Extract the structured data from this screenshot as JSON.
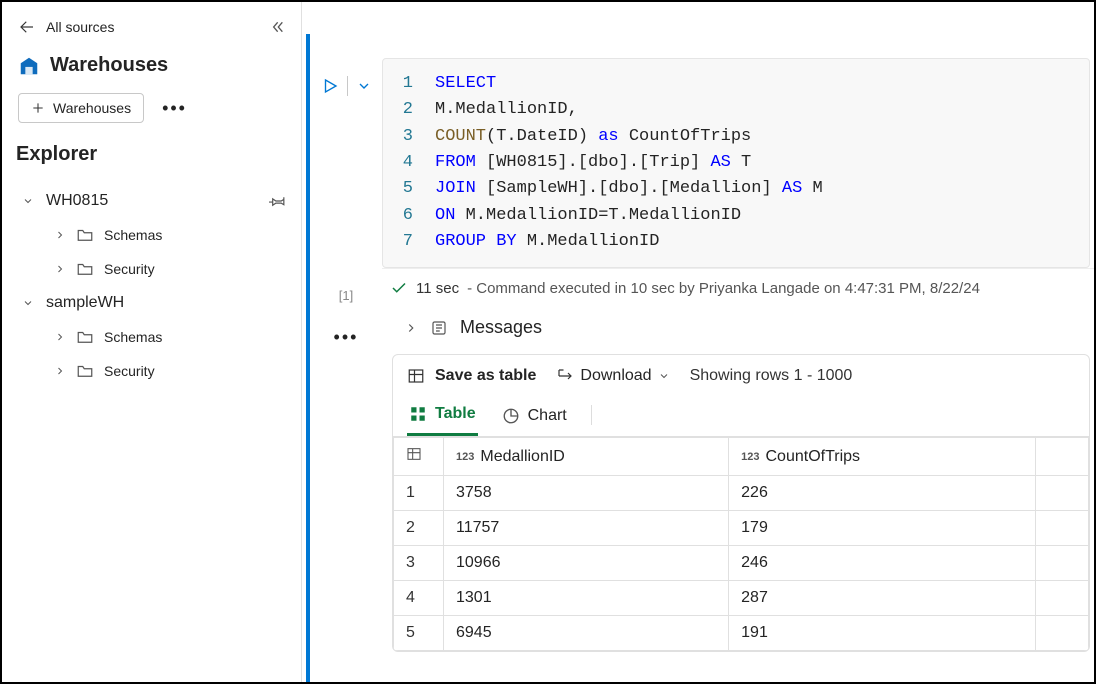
{
  "header": {
    "back_label": "All sources",
    "section_title": "Warehouses",
    "add_button": "Warehouses"
  },
  "explorer": {
    "title": "Explorer",
    "nodes": [
      {
        "label": "WH0815",
        "children": [
          {
            "label": "Schemas"
          },
          {
            "label": "Security"
          }
        ]
      },
      {
        "label": "sampleWH",
        "children": [
          {
            "label": "Schemas"
          },
          {
            "label": "Security"
          }
        ]
      }
    ]
  },
  "editor": {
    "cell_index": "[1]",
    "lines": [
      {
        "n": "1",
        "html": "<span class='kw'>SELECT</span>"
      },
      {
        "n": "2",
        "html": "M.MedallionID,"
      },
      {
        "n": "3",
        "html": "<span class='fn'>COUNT</span>(T.DateID) <span class='kw'>as</span> CountOfTrips"
      },
      {
        "n": "4",
        "html": "<span class='kw'>FROM</span> [WH0815].[dbo].[Trip] <span class='kw'>AS</span> T"
      },
      {
        "n": "5",
        "html": "<span class='kw'>JOIN</span> [SampleWH].[dbo].[Medallion] <span class='kw'>AS</span> M"
      },
      {
        "n": "6",
        "html": "<span class='kw'>ON</span> M.MedallionID=T.MedallionID"
      },
      {
        "n": "7",
        "html": "<span class='kw'>GROUP BY</span> M.MedallionID"
      }
    ]
  },
  "status": {
    "time": "11 sec",
    "text": " - Command executed in 10 sec by Priyanka Langade on 4:47:31 PM, 8/22/24"
  },
  "messages": {
    "label": "Messages"
  },
  "results": {
    "save_label": "Save as table",
    "download_label": "Download",
    "showing_label": "Showing rows 1 - 1000",
    "tabs": {
      "table": "Table",
      "chart": "Chart"
    },
    "columns": [
      "MedallionID",
      "CountOfTrips"
    ],
    "rows": [
      [
        "3758",
        "226"
      ],
      [
        "11757",
        "179"
      ],
      [
        "10966",
        "246"
      ],
      [
        "1301",
        "287"
      ],
      [
        "6945",
        "191"
      ]
    ]
  }
}
